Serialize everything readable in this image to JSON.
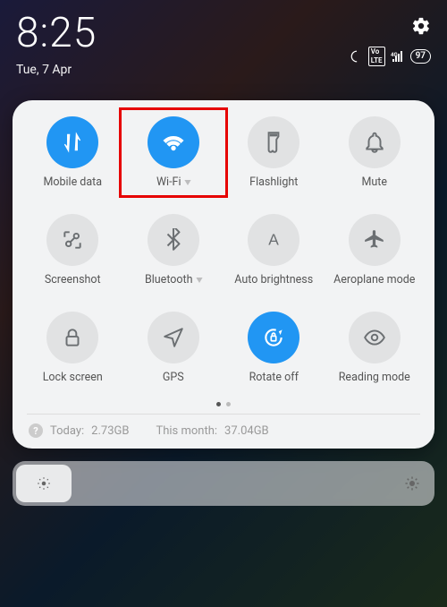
{
  "status": {
    "time": "8:25",
    "date": "Tue, 7 Apr",
    "battery": "97"
  },
  "tiles": [
    {
      "label": "Mobile data"
    },
    {
      "label": "Wi-Fi"
    },
    {
      "label": "Flashlight"
    },
    {
      "label": "Mute"
    },
    {
      "label": "Screenshot"
    },
    {
      "label": "Bluetooth"
    },
    {
      "label": "Auto brightness"
    },
    {
      "label": "Aeroplane mode"
    },
    {
      "label": "Lock screen"
    },
    {
      "label": "GPS"
    },
    {
      "label": "Rotate off"
    },
    {
      "label": "Reading mode"
    }
  ],
  "usage": {
    "today_label": "Today:",
    "today_value": "2.73GB",
    "month_label": "This month:",
    "month_value": "37.04GB"
  }
}
